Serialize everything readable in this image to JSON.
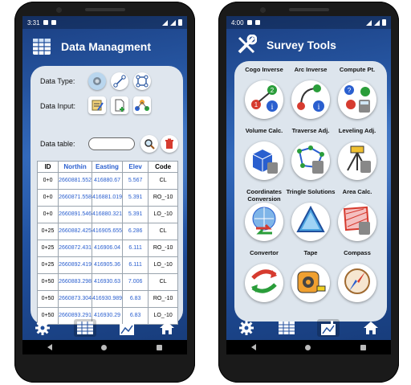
{
  "left_phone": {
    "status_time": "3:31",
    "title": "Data Managment",
    "data_type_label": "Data Type:",
    "data_input_label": "Data Input:",
    "data_table_label": "Data table:",
    "table": {
      "headers": [
        "ID",
        "Northin",
        "Easting",
        "Elev",
        "Code"
      ],
      "rows": [
        [
          "0+0",
          "2660881.552",
          "416880.67",
          "5.567",
          "CL"
        ],
        [
          "0+0",
          "2660871.558",
          "416881.019",
          "5.391",
          "RO_-10"
        ],
        [
          "0+0",
          "2660891.546",
          "416880.321",
          "5.391",
          "LO_-10"
        ],
        [
          "0+25",
          "2660882.425",
          "416905.655",
          "6.286",
          "CL"
        ],
        [
          "0+25",
          "2660872.431",
          "416906.04",
          "6.111",
          "RO_-10"
        ],
        [
          "0+25",
          "2660892.419",
          "416905.36",
          "6.111",
          "LO_-10"
        ],
        [
          "0+50",
          "2660883.298",
          "416930.63",
          "7.006",
          "CL"
        ],
        [
          "0+50",
          "2660873.304",
          "416930.989",
          "6.83",
          "RO_-10"
        ],
        [
          "0+50",
          "2660893.291",
          "416930.29",
          "6.83",
          "LO_-10"
        ]
      ]
    }
  },
  "right_phone": {
    "status_time": "4:00",
    "title": "Survey Tools",
    "tools": [
      {
        "label": "Cogo Inverse",
        "icon": "cogo-inverse-icon"
      },
      {
        "label": "Arc Inverse",
        "icon": "arc-inverse-icon"
      },
      {
        "label": "Compute Pt.",
        "icon": "compute-point-icon"
      },
      {
        "label": "Volume Calc.",
        "icon": "volume-calc-icon"
      },
      {
        "label": "Traverse Adj.",
        "icon": "traverse-adj-icon"
      },
      {
        "label": "Leveling Adj.",
        "icon": "leveling-adj-icon"
      },
      {
        "label": "Coordinates Conversion",
        "icon": "coordinates-conversion-icon"
      },
      {
        "label": "Tringle Solutions",
        "icon": "triangle-solutions-icon"
      },
      {
        "label": "Area Calc.",
        "icon": "area-calc-icon"
      },
      {
        "label": "Convertor",
        "icon": "convertor-icon"
      },
      {
        "label": "Tape",
        "icon": "tape-icon"
      },
      {
        "label": "Compass",
        "icon": "compass-icon"
      }
    ]
  },
  "colors": {
    "accent_blue": "#2a5fcf",
    "panel": "#dfe6ee",
    "background": "#1f4e9c"
  }
}
